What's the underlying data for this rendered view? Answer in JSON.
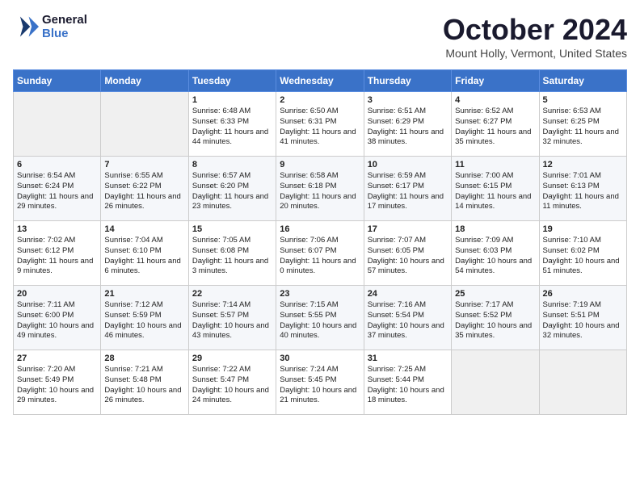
{
  "header": {
    "logo_line1": "General",
    "logo_line2": "Blue",
    "month": "October 2024",
    "location": "Mount Holly, Vermont, United States"
  },
  "days_of_week": [
    "Sunday",
    "Monday",
    "Tuesday",
    "Wednesday",
    "Thursday",
    "Friday",
    "Saturday"
  ],
  "weeks": [
    [
      {
        "num": "",
        "empty": true
      },
      {
        "num": "",
        "empty": true
      },
      {
        "num": "1",
        "sunrise": "6:48 AM",
        "sunset": "6:33 PM",
        "daylight": "11 hours and 44 minutes."
      },
      {
        "num": "2",
        "sunrise": "6:50 AM",
        "sunset": "6:31 PM",
        "daylight": "11 hours and 41 minutes."
      },
      {
        "num": "3",
        "sunrise": "6:51 AM",
        "sunset": "6:29 PM",
        "daylight": "11 hours and 38 minutes."
      },
      {
        "num": "4",
        "sunrise": "6:52 AM",
        "sunset": "6:27 PM",
        "daylight": "11 hours and 35 minutes."
      },
      {
        "num": "5",
        "sunrise": "6:53 AM",
        "sunset": "6:25 PM",
        "daylight": "11 hours and 32 minutes."
      }
    ],
    [
      {
        "num": "6",
        "sunrise": "6:54 AM",
        "sunset": "6:24 PM",
        "daylight": "11 hours and 29 minutes."
      },
      {
        "num": "7",
        "sunrise": "6:55 AM",
        "sunset": "6:22 PM",
        "daylight": "11 hours and 26 minutes."
      },
      {
        "num": "8",
        "sunrise": "6:57 AM",
        "sunset": "6:20 PM",
        "daylight": "11 hours and 23 minutes."
      },
      {
        "num": "9",
        "sunrise": "6:58 AM",
        "sunset": "6:18 PM",
        "daylight": "11 hours and 20 minutes."
      },
      {
        "num": "10",
        "sunrise": "6:59 AM",
        "sunset": "6:17 PM",
        "daylight": "11 hours and 17 minutes."
      },
      {
        "num": "11",
        "sunrise": "7:00 AM",
        "sunset": "6:15 PM",
        "daylight": "11 hours and 14 minutes."
      },
      {
        "num": "12",
        "sunrise": "7:01 AM",
        "sunset": "6:13 PM",
        "daylight": "11 hours and 11 minutes."
      }
    ],
    [
      {
        "num": "13",
        "sunrise": "7:02 AM",
        "sunset": "6:12 PM",
        "daylight": "11 hours and 9 minutes."
      },
      {
        "num": "14",
        "sunrise": "7:04 AM",
        "sunset": "6:10 PM",
        "daylight": "11 hours and 6 minutes."
      },
      {
        "num": "15",
        "sunrise": "7:05 AM",
        "sunset": "6:08 PM",
        "daylight": "11 hours and 3 minutes."
      },
      {
        "num": "16",
        "sunrise": "7:06 AM",
        "sunset": "6:07 PM",
        "daylight": "11 hours and 0 minutes."
      },
      {
        "num": "17",
        "sunrise": "7:07 AM",
        "sunset": "6:05 PM",
        "daylight": "10 hours and 57 minutes."
      },
      {
        "num": "18",
        "sunrise": "7:09 AM",
        "sunset": "6:03 PM",
        "daylight": "10 hours and 54 minutes."
      },
      {
        "num": "19",
        "sunrise": "7:10 AM",
        "sunset": "6:02 PM",
        "daylight": "10 hours and 51 minutes."
      }
    ],
    [
      {
        "num": "20",
        "sunrise": "7:11 AM",
        "sunset": "6:00 PM",
        "daylight": "10 hours and 49 minutes."
      },
      {
        "num": "21",
        "sunrise": "7:12 AM",
        "sunset": "5:59 PM",
        "daylight": "10 hours and 46 minutes."
      },
      {
        "num": "22",
        "sunrise": "7:14 AM",
        "sunset": "5:57 PM",
        "daylight": "10 hours and 43 minutes."
      },
      {
        "num": "23",
        "sunrise": "7:15 AM",
        "sunset": "5:55 PM",
        "daylight": "10 hours and 40 minutes."
      },
      {
        "num": "24",
        "sunrise": "7:16 AM",
        "sunset": "5:54 PM",
        "daylight": "10 hours and 37 minutes."
      },
      {
        "num": "25",
        "sunrise": "7:17 AM",
        "sunset": "5:52 PM",
        "daylight": "10 hours and 35 minutes."
      },
      {
        "num": "26",
        "sunrise": "7:19 AM",
        "sunset": "5:51 PM",
        "daylight": "10 hours and 32 minutes."
      }
    ],
    [
      {
        "num": "27",
        "sunrise": "7:20 AM",
        "sunset": "5:49 PM",
        "daylight": "10 hours and 29 minutes."
      },
      {
        "num": "28",
        "sunrise": "7:21 AM",
        "sunset": "5:48 PM",
        "daylight": "10 hours and 26 minutes."
      },
      {
        "num": "29",
        "sunrise": "7:22 AM",
        "sunset": "5:47 PM",
        "daylight": "10 hours and 24 minutes."
      },
      {
        "num": "30",
        "sunrise": "7:24 AM",
        "sunset": "5:45 PM",
        "daylight": "10 hours and 21 minutes."
      },
      {
        "num": "31",
        "sunrise": "7:25 AM",
        "sunset": "5:44 PM",
        "daylight": "10 hours and 18 minutes."
      },
      {
        "num": "",
        "empty": true
      },
      {
        "num": "",
        "empty": true
      }
    ]
  ]
}
